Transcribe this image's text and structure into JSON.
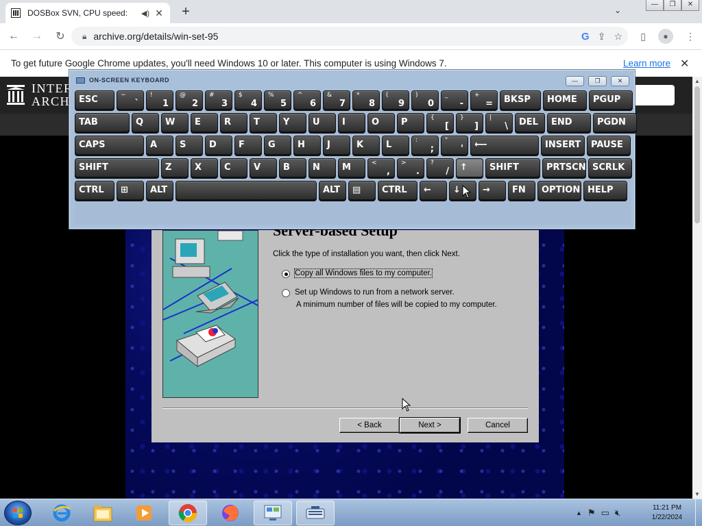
{
  "browser": {
    "tab": {
      "title": "DOSBox SVN, CPU speed:",
      "audio": "◀)",
      "close": "✕"
    },
    "new_tab": "+",
    "tab_list": "⌄",
    "window_buttons": [
      "—",
      "❐",
      "✕"
    ],
    "nav": {
      "back": "←",
      "forward": "→",
      "reload": "↻"
    },
    "url": "archive.org/details/win-set-95",
    "omnibox_icons": {
      "google": "G",
      "share": "⇪",
      "star": "☆"
    },
    "toolbar_icons": {
      "sidepanel": "▯",
      "menu": "⋮"
    }
  },
  "infobar": {
    "message": "To get future Google Chrome updates, you'll need Windows 10 or later. This computer is using Windows 7.",
    "link": "Learn more",
    "close": "✕"
  },
  "archive": {
    "logo_line1": "INTER",
    "logo_line2": "ARCHI"
  },
  "osk": {
    "title": "ON-SCREEN KEYBOARD",
    "controls": [
      "—",
      "❐",
      "✕"
    ],
    "rows": [
      [
        {
          "main": "ESC"
        },
        {
          "top": "~",
          "bot": "`"
        },
        {
          "top": "!",
          "bot": "1"
        },
        {
          "top": "@",
          "bot": "2"
        },
        {
          "top": "#",
          "bot": "3"
        },
        {
          "top": "$",
          "bot": "4"
        },
        {
          "top": "%",
          "bot": "5"
        },
        {
          "top": "^",
          "bot": "6"
        },
        {
          "top": "&",
          "bot": "7"
        },
        {
          "top": "*",
          "bot": "8"
        },
        {
          "top": "(",
          "bot": "9"
        },
        {
          "top": ")",
          "bot": "0"
        },
        {
          "top": "_",
          "bot": "-"
        },
        {
          "top": "+",
          "bot": "="
        },
        {
          "main": "BKSP"
        },
        {
          "main": "HOME"
        },
        {
          "main": "PGUP"
        }
      ],
      [
        {
          "main": "TAB"
        },
        {
          "main": "Q"
        },
        {
          "main": "W"
        },
        {
          "main": "E"
        },
        {
          "main": "R"
        },
        {
          "main": "T"
        },
        {
          "main": "Y"
        },
        {
          "main": "U"
        },
        {
          "main": "I"
        },
        {
          "main": "O"
        },
        {
          "main": "P"
        },
        {
          "top": "{",
          "bot": "["
        },
        {
          "top": "}",
          "bot": "]"
        },
        {
          "top": "|",
          "bot": "\\"
        },
        {
          "main": "DEL"
        },
        {
          "main": "END"
        },
        {
          "main": "PGDN"
        }
      ],
      [
        {
          "main": "CAPS"
        },
        {
          "main": "A"
        },
        {
          "main": "S"
        },
        {
          "main": "D"
        },
        {
          "main": "F"
        },
        {
          "main": "G"
        },
        {
          "main": "H"
        },
        {
          "main": "J"
        },
        {
          "main": "K"
        },
        {
          "main": "L"
        },
        {
          "top": ":",
          "bot": ";"
        },
        {
          "top": "\"",
          "bot": "'"
        },
        {
          "main": "⟵"
        },
        {
          "main": "INSERT"
        },
        {
          "main": "PAUSE"
        }
      ],
      [
        {
          "main": "SHIFT"
        },
        {
          "main": "Z"
        },
        {
          "main": "X"
        },
        {
          "main": "C"
        },
        {
          "main": "V"
        },
        {
          "main": "B"
        },
        {
          "main": "N"
        },
        {
          "main": "M"
        },
        {
          "top": "<",
          "bot": ","
        },
        {
          "top": ">",
          "bot": "."
        },
        {
          "top": "?",
          "bot": "/"
        },
        {
          "main": "↑"
        },
        {
          "main": "SHIFT"
        },
        {
          "main": "PRTSCN"
        },
        {
          "main": "SCRLK"
        }
      ],
      [
        {
          "main": "CTRL"
        },
        {
          "main": "⊞"
        },
        {
          "main": "ALT"
        },
        {
          "main": ""
        },
        {
          "main": "ALT"
        },
        {
          "main": "▤"
        },
        {
          "main": "CTRL"
        },
        {
          "main": "←"
        },
        {
          "main": "↓"
        },
        {
          "main": "→"
        },
        {
          "main": "FN"
        },
        {
          "main": "OPTIONS"
        },
        {
          "main": "HELP"
        }
      ]
    ]
  },
  "setup": {
    "heading": "Server-based Setup",
    "prompt": "Click the type of installation you want, then click Next.",
    "option1": "Copy all Windows files to my computer.",
    "option2": "Set up Windows to run from a network server.",
    "option2_sub": "A minimum number of files will be copied to my computer.",
    "selected": "option1",
    "back": "< Back",
    "next": "Next >",
    "cancel": "Cancel"
  },
  "taskbar": {
    "items": [
      "start",
      "ie-icon",
      "explorer-icon",
      "media-player-icon",
      "chrome-icon",
      "firefox-icon",
      "control-panel-icon",
      "osk-icon"
    ],
    "tray_arrow": "▲",
    "clock_time": "11:21 PM",
    "clock_date": "1/22/2024"
  },
  "colors": {
    "tab_strip": "#dee1e6",
    "osk_frame": "#a9c0da",
    "win95_face": "#c0c0c0",
    "setup_art": "#5fb2aa",
    "taskbar": "#7c9cc4"
  }
}
